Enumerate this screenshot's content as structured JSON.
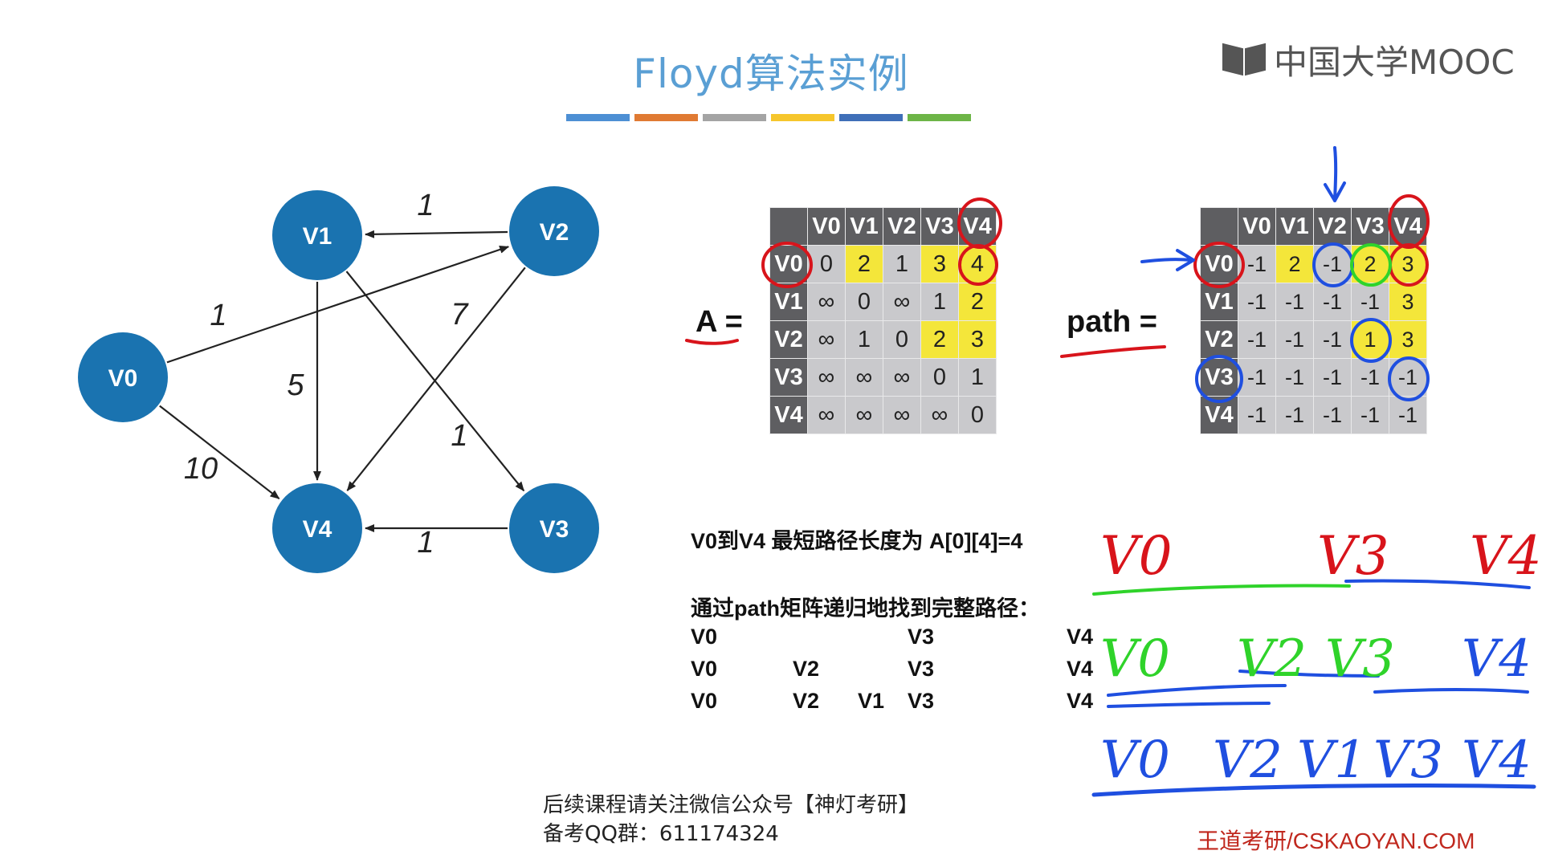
{
  "slide": {
    "title": "Floyd算法实例",
    "strip_colors": [
      "#4d8fd4",
      "#e07a33",
      "#a4a4a4",
      "#f6c62c",
      "#3f6fb8",
      "#6db547"
    ],
    "logo_text": "中国大学MOOC"
  },
  "graph": {
    "nodes": [
      {
        "id": "V0",
        "label": "V0"
      },
      {
        "id": "V1",
        "label": "V1"
      },
      {
        "id": "V2",
        "label": "V2"
      },
      {
        "id": "V3",
        "label": "V3"
      },
      {
        "id": "V4",
        "label": "V4"
      }
    ],
    "edges": [
      {
        "from": "V2",
        "to": "V1",
        "weight": "1"
      },
      {
        "from": "V0",
        "to": "V2",
        "weight": "1"
      },
      {
        "from": "V0",
        "to": "V4",
        "weight": "10"
      },
      {
        "from": "V1",
        "to": "V4",
        "weight": "5"
      },
      {
        "from": "V2",
        "to": "V4",
        "weight": "7"
      },
      {
        "from": "V1",
        "to": "V3",
        "weight": "1"
      },
      {
        "from": "V3",
        "to": "V4",
        "weight": "1"
      }
    ],
    "node_color": "#1a73b0"
  },
  "matrices": {
    "A": {
      "label": "A =",
      "cols": [
        "V0",
        "V1",
        "V2",
        "V3",
        "V4"
      ],
      "rows": [
        {
          "head": "V0",
          "cells": [
            "0",
            "2",
            "1",
            "3",
            "4"
          ]
        },
        {
          "head": "V1",
          "cells": [
            "∞",
            "0",
            "∞",
            "1",
            "2"
          ]
        },
        {
          "head": "V2",
          "cells": [
            "∞",
            "1",
            "0",
            "2",
            "3"
          ]
        },
        {
          "head": "V3",
          "cells": [
            "∞",
            "∞",
            "∞",
            "0",
            "1"
          ]
        },
        {
          "head": "V4",
          "cells": [
            "∞",
            "∞",
            "∞",
            "∞",
            "0"
          ]
        }
      ]
    },
    "path": {
      "label": "path =",
      "cols": [
        "V0",
        "V1",
        "V2",
        "V3",
        "V4"
      ],
      "rows": [
        {
          "head": "V0",
          "cells": [
            "-1",
            "2",
            "-1",
            "2",
            "3"
          ]
        },
        {
          "head": "V1",
          "cells": [
            "-1",
            "-1",
            "-1",
            "-1",
            "3"
          ]
        },
        {
          "head": "V2",
          "cells": [
            "-1",
            "-1",
            "-1",
            "1",
            "3"
          ]
        },
        {
          "head": "V3",
          "cells": [
            "-1",
            "-1",
            "-1",
            "-1",
            "-1"
          ]
        },
        {
          "head": "V4",
          "cells": [
            "-1",
            "-1",
            "-1",
            "-1",
            "-1"
          ]
        }
      ]
    }
  },
  "text": {
    "shortest": "V0到V4 最短路径长度为 A[0][4]=4",
    "recursive": "通过path矩阵递归地找到完整路径：",
    "path_rows": [
      [
        "V0",
        "",
        "",
        "V3",
        "V4"
      ],
      [
        "V0",
        "V2",
        "",
        "V3",
        "V4"
      ],
      [
        "V0",
        "V2",
        "V1",
        "V3",
        "V4"
      ]
    ],
    "notice1": "后续课程请关注微信公众号【神灯考研】",
    "notice2": "备考QQ群：611174324",
    "brand": "王道考研/CSKAOYAN.COM"
  },
  "handwriting": {
    "line1": [
      "V0",
      "V3",
      "V4"
    ],
    "line2": [
      "V0",
      "V2",
      "V3",
      "V4"
    ],
    "line3": [
      "V0",
      "V2",
      "V1",
      "V3",
      "V4"
    ],
    "colors": {
      "red": "#d8141b",
      "green": "#2fd32a",
      "blue": "#1f4fe0"
    }
  }
}
